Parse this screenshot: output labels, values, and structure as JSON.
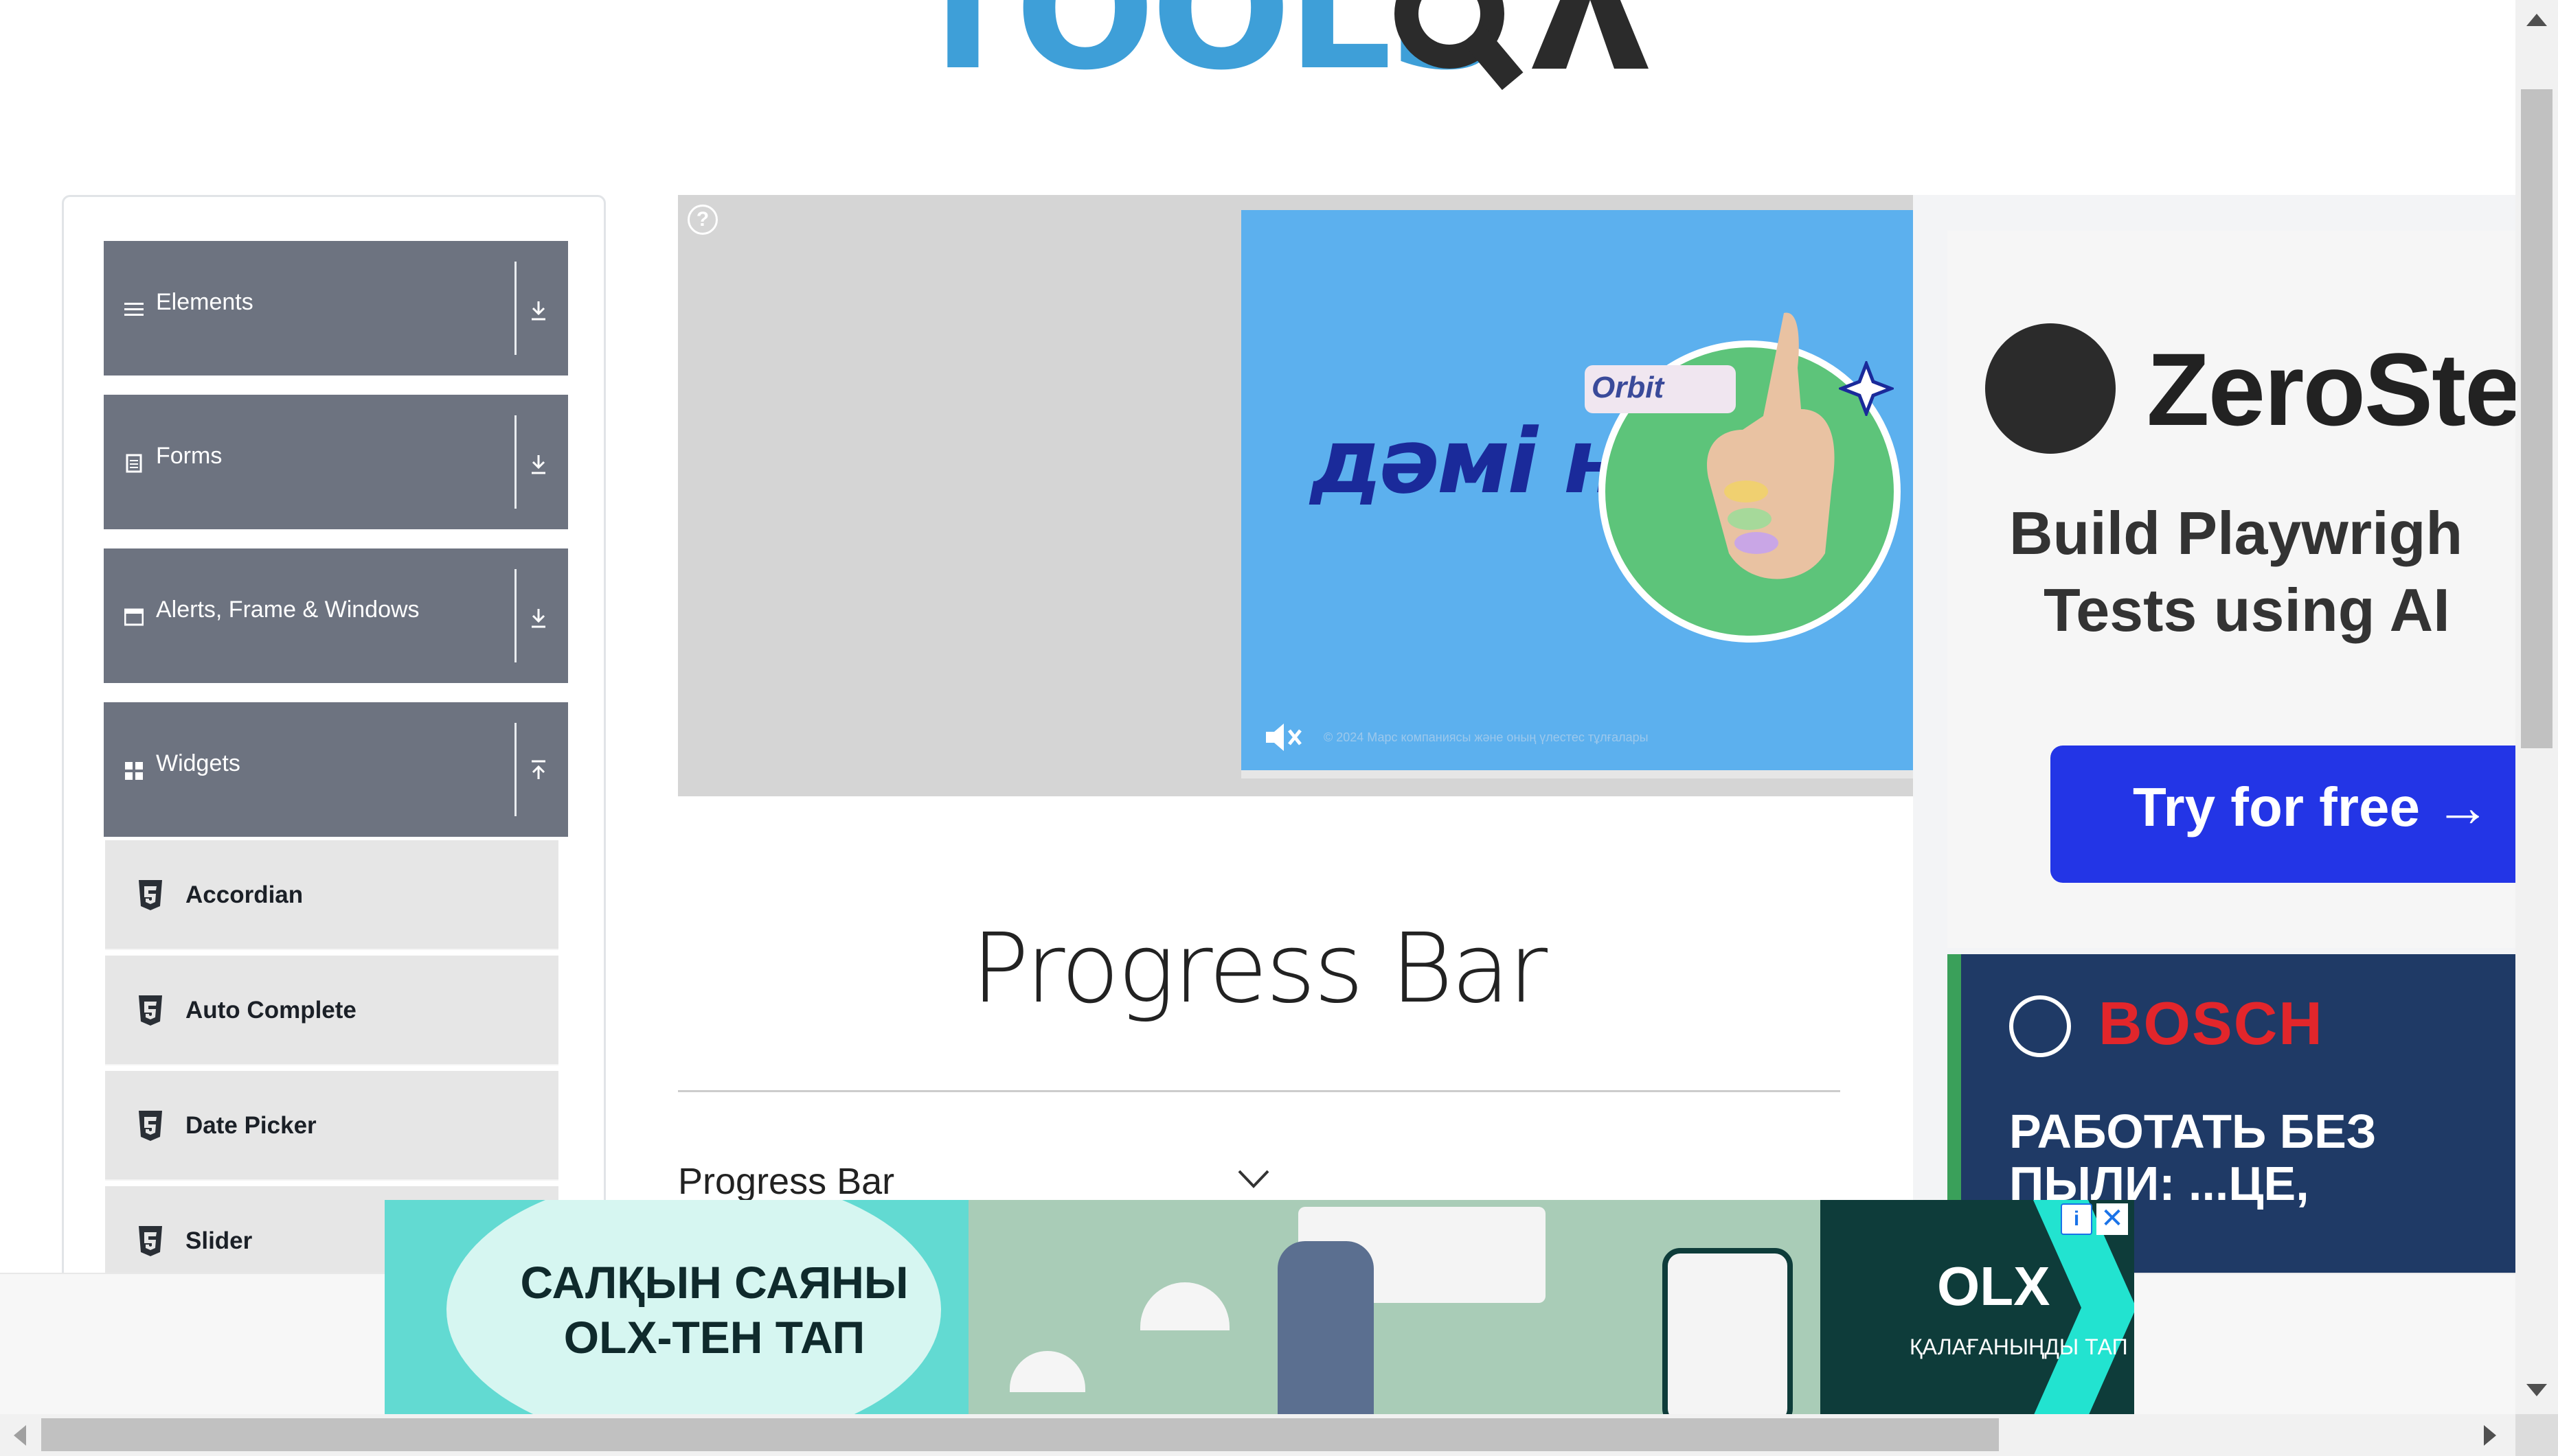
{
  "sidebar": {
    "groups": [
      {
        "label": "Elements",
        "icon": "list-icon",
        "expanded": false
      },
      {
        "label": "Forms",
        "icon": "document-icon",
        "expanded": false
      },
      {
        "label": "Alerts, Frame & Windows",
        "icon": "window-icon",
        "expanded": false
      },
      {
        "label": "Widgets",
        "icon": "grid-icon",
        "expanded": true
      }
    ],
    "widget_items": [
      {
        "label": "Accordian",
        "icon": "html5-icon"
      },
      {
        "label": "Auto Complete",
        "icon": "html5-icon"
      },
      {
        "label": "Date Picker",
        "icon": "html5-icon"
      },
      {
        "label": "Slider",
        "icon": "html5-icon"
      }
    ]
  },
  "main": {
    "page_title": "Progress Bar",
    "accordion_title": "Progress Bar"
  },
  "ads": {
    "top_ad": {
      "headline": "дәмі н",
      "brand": "Orbit",
      "copyright": "© 2024 Марс компаниясы және оның үлестес тұлғалары"
    },
    "right_ad_zerostep": {
      "title": "ZeroSte",
      "subtitle_line1": "Build Playwrigh",
      "subtitle_line2": "Tests using AI",
      "cta": "Try for free →"
    },
    "right_ad_bosch": {
      "brand": "BOSCH",
      "text": "РАБОТАТЬ БЕЗ ПЫЛИ: ...ЦЕ,"
    },
    "bottom_ad": {
      "left_text_line1": "САЛҚЫН САЯНЫ",
      "left_text_line2": "OLX-ТЕН ТАП",
      "brand": "OLX",
      "right_text": "ҚАЛАҒАНЫҢДЫ ТАП",
      "info": "i",
      "close": "✕"
    }
  },
  "logo": {
    "text": "TOOLS"
  },
  "colors": {
    "sidebar_header": "#6d7380",
    "sidebar_item": "#e6e6e6",
    "accent_blue": "#3e9fd8"
  }
}
